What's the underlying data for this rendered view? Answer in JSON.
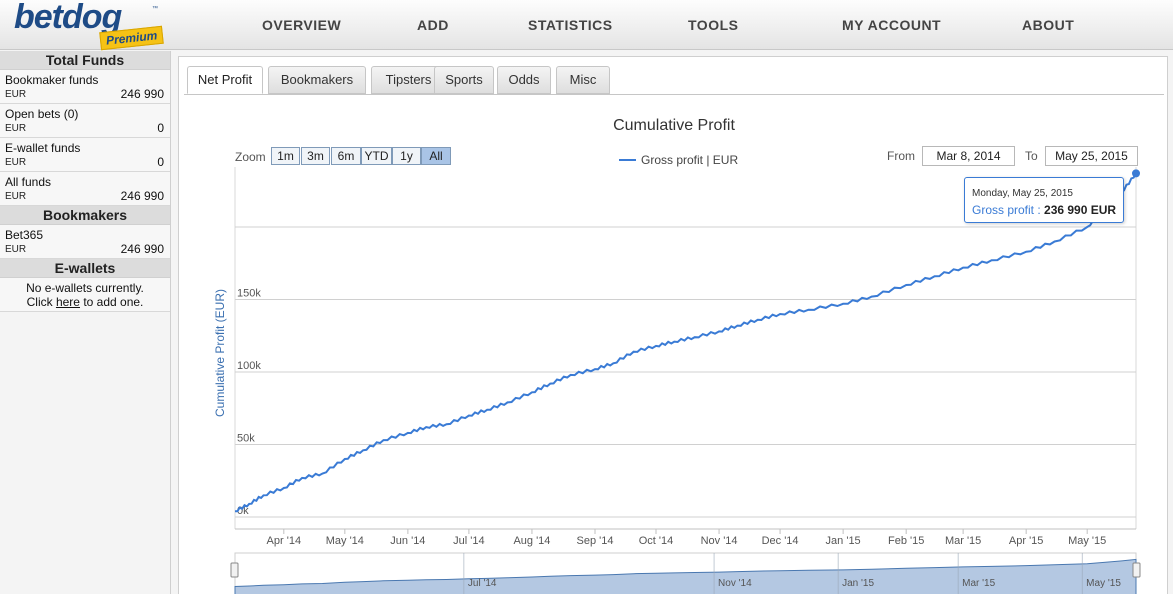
{
  "logo": {
    "text": "betdog",
    "tm": "™",
    "badge": "Premium"
  },
  "nav": [
    "OVERVIEW",
    "ADD",
    "STATISTICS",
    "TOOLS",
    "MY ACCOUNT",
    "ABOUT"
  ],
  "sidebar": {
    "total_funds": {
      "title": "Total Funds",
      "rows": [
        {
          "label": "Bookmaker funds",
          "currency": "EUR",
          "value": "246 990"
        },
        {
          "label": "Open bets (0)",
          "currency": "EUR",
          "value": "0"
        },
        {
          "label": "E-wallet funds",
          "currency": "EUR",
          "value": "0"
        },
        {
          "label": "All funds",
          "currency": "EUR",
          "value": "246 990"
        }
      ]
    },
    "bookmakers": {
      "title": "Bookmakers",
      "rows": [
        {
          "label": "Bet365",
          "currency": "EUR",
          "value": "246 990"
        }
      ]
    },
    "ewallets": {
      "title": "E-wallets",
      "note_line1": "No e-wallets currently.",
      "note_pre": "Click ",
      "note_link": "here",
      "note_post": " to add one."
    }
  },
  "tabs": [
    "Net Profit",
    "Bookmakers",
    "Tipsters",
    "Sports",
    "Odds",
    "Misc"
  ],
  "active_tab": "Net Profit",
  "controls": {
    "zoom_label": "Zoom",
    "zoom_buttons": [
      "1m",
      "3m",
      "6m",
      "YTD",
      "1y",
      "All"
    ],
    "zoom_active": "All",
    "from_label": "From",
    "from_value": "Mar 8, 2014",
    "to_label": "To",
    "to_value": "May 25, 2015"
  },
  "tooltip": {
    "date": "Monday, May 25, 2015",
    "series": "Gross profit",
    "value": "236 990 EUR"
  },
  "colors": {
    "line": "#3a7bd5",
    "navigator_fill": "#b4c8e2",
    "brand": "#1e4b86",
    "badge": "#f5c215"
  },
  "chart_data": {
    "type": "line",
    "title": "Cumulative Profit",
    "ylabel": "Cumulative Profit (EUR)",
    "xlabel": "",
    "legend": "top-center",
    "grid": true,
    "ylim": [
      0,
      240000
    ],
    "xlim": [
      "2014-03-08",
      "2015-05-25"
    ],
    "y_ticks": [
      {
        "value": 0,
        "label": "0k"
      },
      {
        "value": 50000,
        "label": "50k"
      },
      {
        "value": 100000,
        "label": "100k"
      },
      {
        "value": 150000,
        "label": "150k"
      },
      {
        "value": 200000,
        "label": ""
      }
    ],
    "x_ticks": [
      {
        "date": "2014-04-01",
        "label": "Apr '14"
      },
      {
        "date": "2014-05-01",
        "label": "May '14"
      },
      {
        "date": "2014-06-01",
        "label": "Jun '14"
      },
      {
        "date": "2014-07-01",
        "label": "Jul '14"
      },
      {
        "date": "2014-08-01",
        "label": "Aug '14"
      },
      {
        "date": "2014-09-01",
        "label": "Sep '14"
      },
      {
        "date": "2014-10-01",
        "label": "Oct '14"
      },
      {
        "date": "2014-11-01",
        "label": "Nov '14"
      },
      {
        "date": "2014-12-01",
        "label": "Dec '14"
      },
      {
        "date": "2015-01-01",
        "label": "Jan '15"
      },
      {
        "date": "2015-02-01",
        "label": "Feb '15"
      },
      {
        "date": "2015-03-01",
        "label": "Mar '15"
      },
      {
        "date": "2015-04-01",
        "label": "Apr '15"
      },
      {
        "date": "2015-05-01",
        "label": "May '15"
      }
    ],
    "navigator_ticks": [
      {
        "date": "2014-07-01",
        "label": "Jul '14"
      },
      {
        "date": "2014-11-01",
        "label": "Nov '14"
      },
      {
        "date": "2015-01-01",
        "label": "Jan '15"
      },
      {
        "date": "2015-03-01",
        "label": "Mar '15"
      },
      {
        "date": "2015-05-01",
        "label": "May '15"
      }
    ],
    "series": [
      {
        "name": "Gross profit | EUR",
        "points": [
          [
            "2014-03-08",
            4000
          ],
          [
            "2014-03-15",
            9000
          ],
          [
            "2014-03-22",
            15000
          ],
          [
            "2014-04-01",
            20000
          ],
          [
            "2014-04-10",
            27000
          ],
          [
            "2014-04-20",
            30000
          ],
          [
            "2014-05-01",
            40000
          ],
          [
            "2014-05-10",
            46000
          ],
          [
            "2014-05-20",
            53000
          ],
          [
            "2014-06-01",
            58000
          ],
          [
            "2014-06-10",
            62000
          ],
          [
            "2014-06-20",
            64000
          ],
          [
            "2014-07-01",
            70000
          ],
          [
            "2014-07-10",
            74000
          ],
          [
            "2014-07-20",
            79000
          ],
          [
            "2014-08-01",
            86000
          ],
          [
            "2014-08-10",
            92000
          ],
          [
            "2014-08-20",
            98000
          ],
          [
            "2014-09-01",
            102000
          ],
          [
            "2014-09-10",
            106000
          ],
          [
            "2014-09-20",
            114000
          ],
          [
            "2014-10-01",
            118000
          ],
          [
            "2014-10-10",
            121000
          ],
          [
            "2014-10-20",
            124000
          ],
          [
            "2014-11-01",
            128000
          ],
          [
            "2014-11-10",
            132000
          ],
          [
            "2014-11-20",
            136000
          ],
          [
            "2014-12-01",
            140000
          ],
          [
            "2014-12-15",
            143000
          ],
          [
            "2015-01-01",
            147000
          ],
          [
            "2015-01-15",
            152000
          ],
          [
            "2015-02-01",
            160000
          ],
          [
            "2015-02-15",
            166000
          ],
          [
            "2015-03-01",
            172000
          ],
          [
            "2015-03-15",
            177000
          ],
          [
            "2015-04-01",
            183000
          ],
          [
            "2015-04-15",
            190000
          ],
          [
            "2015-05-01",
            200000
          ],
          [
            "2015-05-10",
            212000
          ],
          [
            "2015-05-18",
            224000
          ],
          [
            "2015-05-25",
            236990
          ]
        ]
      }
    ]
  }
}
